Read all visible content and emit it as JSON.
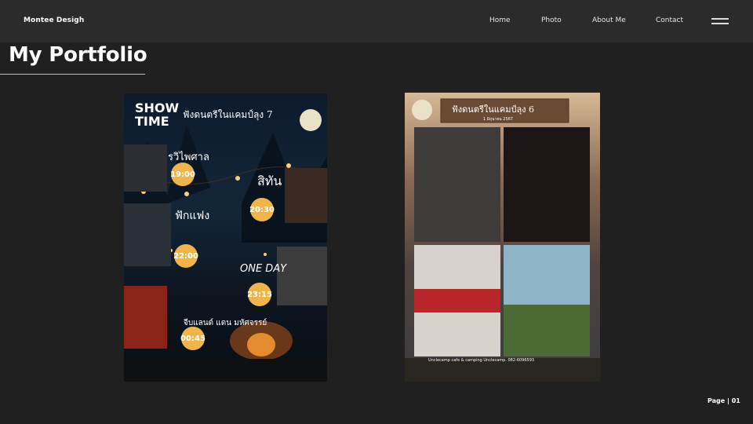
{
  "header": {
    "brand": "Montee Desigh",
    "nav": [
      {
        "label": "Home"
      },
      {
        "label": "Photo"
      },
      {
        "label": "About Me"
      },
      {
        "label": "Contact"
      }
    ]
  },
  "main": {
    "title": "My Portfolio"
  },
  "poster1": {
    "show_time": "SHOW TIME",
    "headline": "ฟังดนตรีในแคมป์ลุง 7",
    "number": "7",
    "performers": [
      "รวิไพศาล",
      "สิทัน",
      "ฟักแฟง",
      "ONE DAY",
      "จีบแลนด์ แดน มหัศจรรย์"
    ],
    "times": [
      "19:00",
      "20:30",
      "22:00",
      "23:15",
      "00:45"
    ]
  },
  "poster2": {
    "headline": "ฟังดนตรีในแคมป์ลุง 6",
    "number": "6",
    "date": "1 มิถุนายน 2567",
    "contact": "Unclecamp cafe & camping   Unclecamp.   082-6096593"
  },
  "footer": {
    "page_label": "Page | 01"
  },
  "colors": {
    "background": "#202020",
    "topbar": "#2b2b2b",
    "badge": "#f0b54a"
  }
}
